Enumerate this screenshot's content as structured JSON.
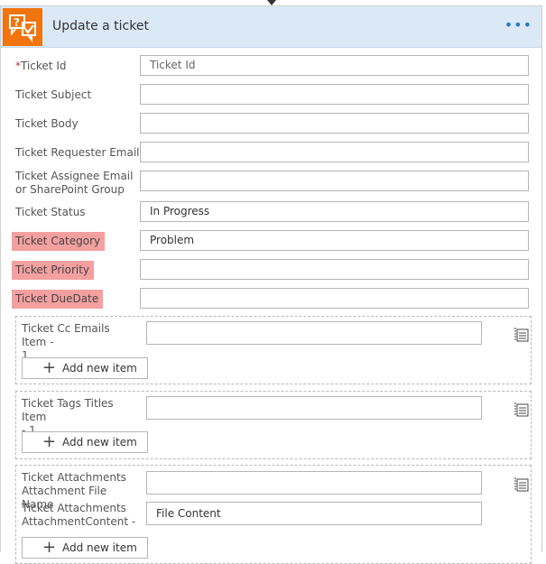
{
  "header": {
    "title": "Update a ticket",
    "more_label": "•••"
  },
  "fields": {
    "ticket_id": {
      "required_mark": "*",
      "label": "Ticket Id",
      "placeholder": "Ticket Id"
    },
    "subject": {
      "label": "Ticket Subject",
      "value": ""
    },
    "body": {
      "label": "Ticket Body",
      "value": ""
    },
    "requester_email": {
      "label": "Ticket Requester Email",
      "value": ""
    },
    "assignee": {
      "label_line1": "Ticket Assignee Email",
      "label_line2": "or SharePoint Group",
      "value": ""
    },
    "status": {
      "label": "Ticket Status",
      "value": "In Progress"
    },
    "category": {
      "label": "Ticket Category",
      "value": "Problem"
    },
    "priority": {
      "label": "Ticket Priority",
      "value": ""
    },
    "due_date": {
      "label": "Ticket DueDate",
      "value": ""
    }
  },
  "arrays": {
    "cc_emails": {
      "label_line1": "Ticket Cc Emails Item -",
      "label_line2": "1",
      "value": "",
      "add_label": "Add new item"
    },
    "tags": {
      "label_line1": "Ticket Tags Titles Item",
      "label_line2": "- 1",
      "value": "",
      "add_label": "Add new item"
    },
    "attachments": {
      "name_line1": "Ticket Attachments",
      "name_line2": "Attachment File Name",
      "name_value": "",
      "content_line1": "Ticket Attachments",
      "content_line2": "AttachmentContent -",
      "content_value": "File Content",
      "add_label": "Add new item"
    }
  }
}
